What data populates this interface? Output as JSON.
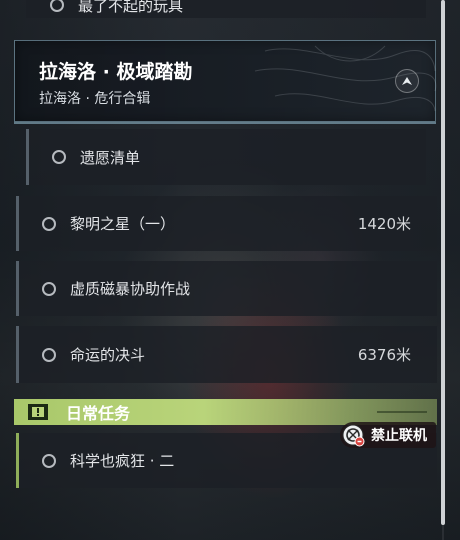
{
  "top_item": {
    "label": "最了不起的玩具"
  },
  "chapter": {
    "title": "拉海洛 · 极域踏勘",
    "subtitle": "拉海洛 · 危行合辑",
    "collapse_icon": "chevron-up-icon"
  },
  "quests": [
    {
      "label": "遗愿清单",
      "distance": ""
    },
    {
      "label": "黎明之星（一）",
      "distance": "1420米"
    },
    {
      "label": "虚质磁暴协助作战",
      "distance": ""
    },
    {
      "label": "命运的决斗",
      "distance": "6376米"
    }
  ],
  "daily": {
    "header": "日常任务",
    "icon": "exclamation-icon",
    "accent": "#b9d47a",
    "items": [
      {
        "label": "科学也疯狂 · 二",
        "distance": ""
      }
    ]
  },
  "badge": {
    "label": "禁止联机",
    "icon": "no-multiplayer-icon"
  },
  "colors": {
    "panel": "#1c2026",
    "highlight_border": "#8fb6c8",
    "accent_green": "#b9d47a"
  }
}
